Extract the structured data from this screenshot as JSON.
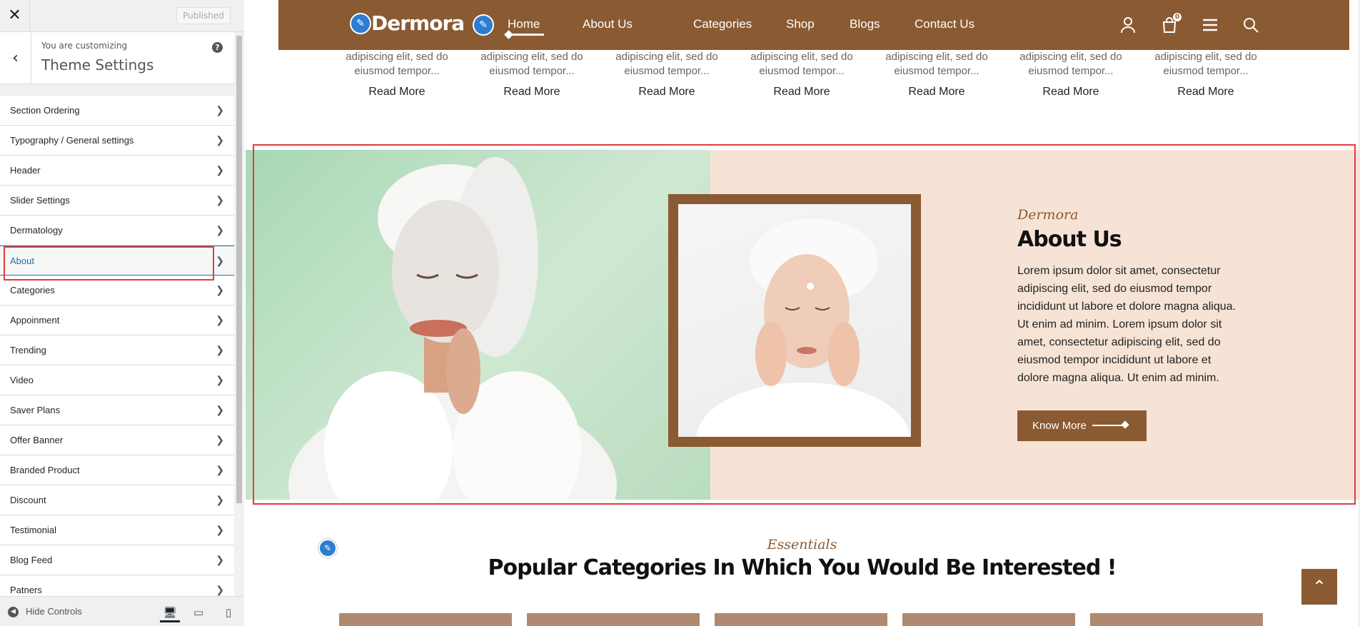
{
  "sidebar": {
    "published_label": "Published",
    "customizing_label": "You are customizing",
    "panel_title": "Theme Settings",
    "items": [
      {
        "label": "Section Ordering"
      },
      {
        "label": "Typography / General settings"
      },
      {
        "label": "Header"
      },
      {
        "label": "Slider Settings"
      },
      {
        "label": "Dermatology"
      },
      {
        "label": "About"
      },
      {
        "label": "Categories"
      },
      {
        "label": "Appoinment"
      },
      {
        "label": "Trending"
      },
      {
        "label": "Video"
      },
      {
        "label": "Saver Plans"
      },
      {
        "label": "Offer Banner"
      },
      {
        "label": "Branded Product"
      },
      {
        "label": "Discount"
      },
      {
        "label": "Testimonial"
      },
      {
        "label": "Blog Feed"
      },
      {
        "label": "Patners"
      }
    ],
    "hide_controls_label": "Hide Controls"
  },
  "nav": {
    "logo_text": "Dermora",
    "links": [
      "Home",
      "About Us",
      "Categories",
      "Shop",
      "Blogs",
      "Contact Us"
    ],
    "cart_count": "0"
  },
  "blog": {
    "excerpt_line1": "adipiscing elit, sed do",
    "excerpt_line2": "eiusmod tempor...",
    "read_more": "Read More"
  },
  "about": {
    "tag": "Dermora",
    "title": "About Us",
    "text": "Lorem ipsum dolor sit amet, consectetur adipiscing elit, sed do eiusmod tempor incididunt ut labore et dolore magna aliqua. Ut enim ad minim. Lorem ipsum dolor sit amet, consectetur adipiscing elit, sed do eiusmod tempor incididunt ut labore et dolore magna aliqua. Ut enim ad minim.",
    "button_label": "Know More"
  },
  "essentials": {
    "tag": "Essentials",
    "title": "Popular Categories In Which You Would Be Interested !"
  },
  "colors": {
    "brand": "#8a5a32",
    "about_bg": "#f7e3d6",
    "accent_blue": "#2271b1",
    "highlight_red": "#e03c3c"
  }
}
